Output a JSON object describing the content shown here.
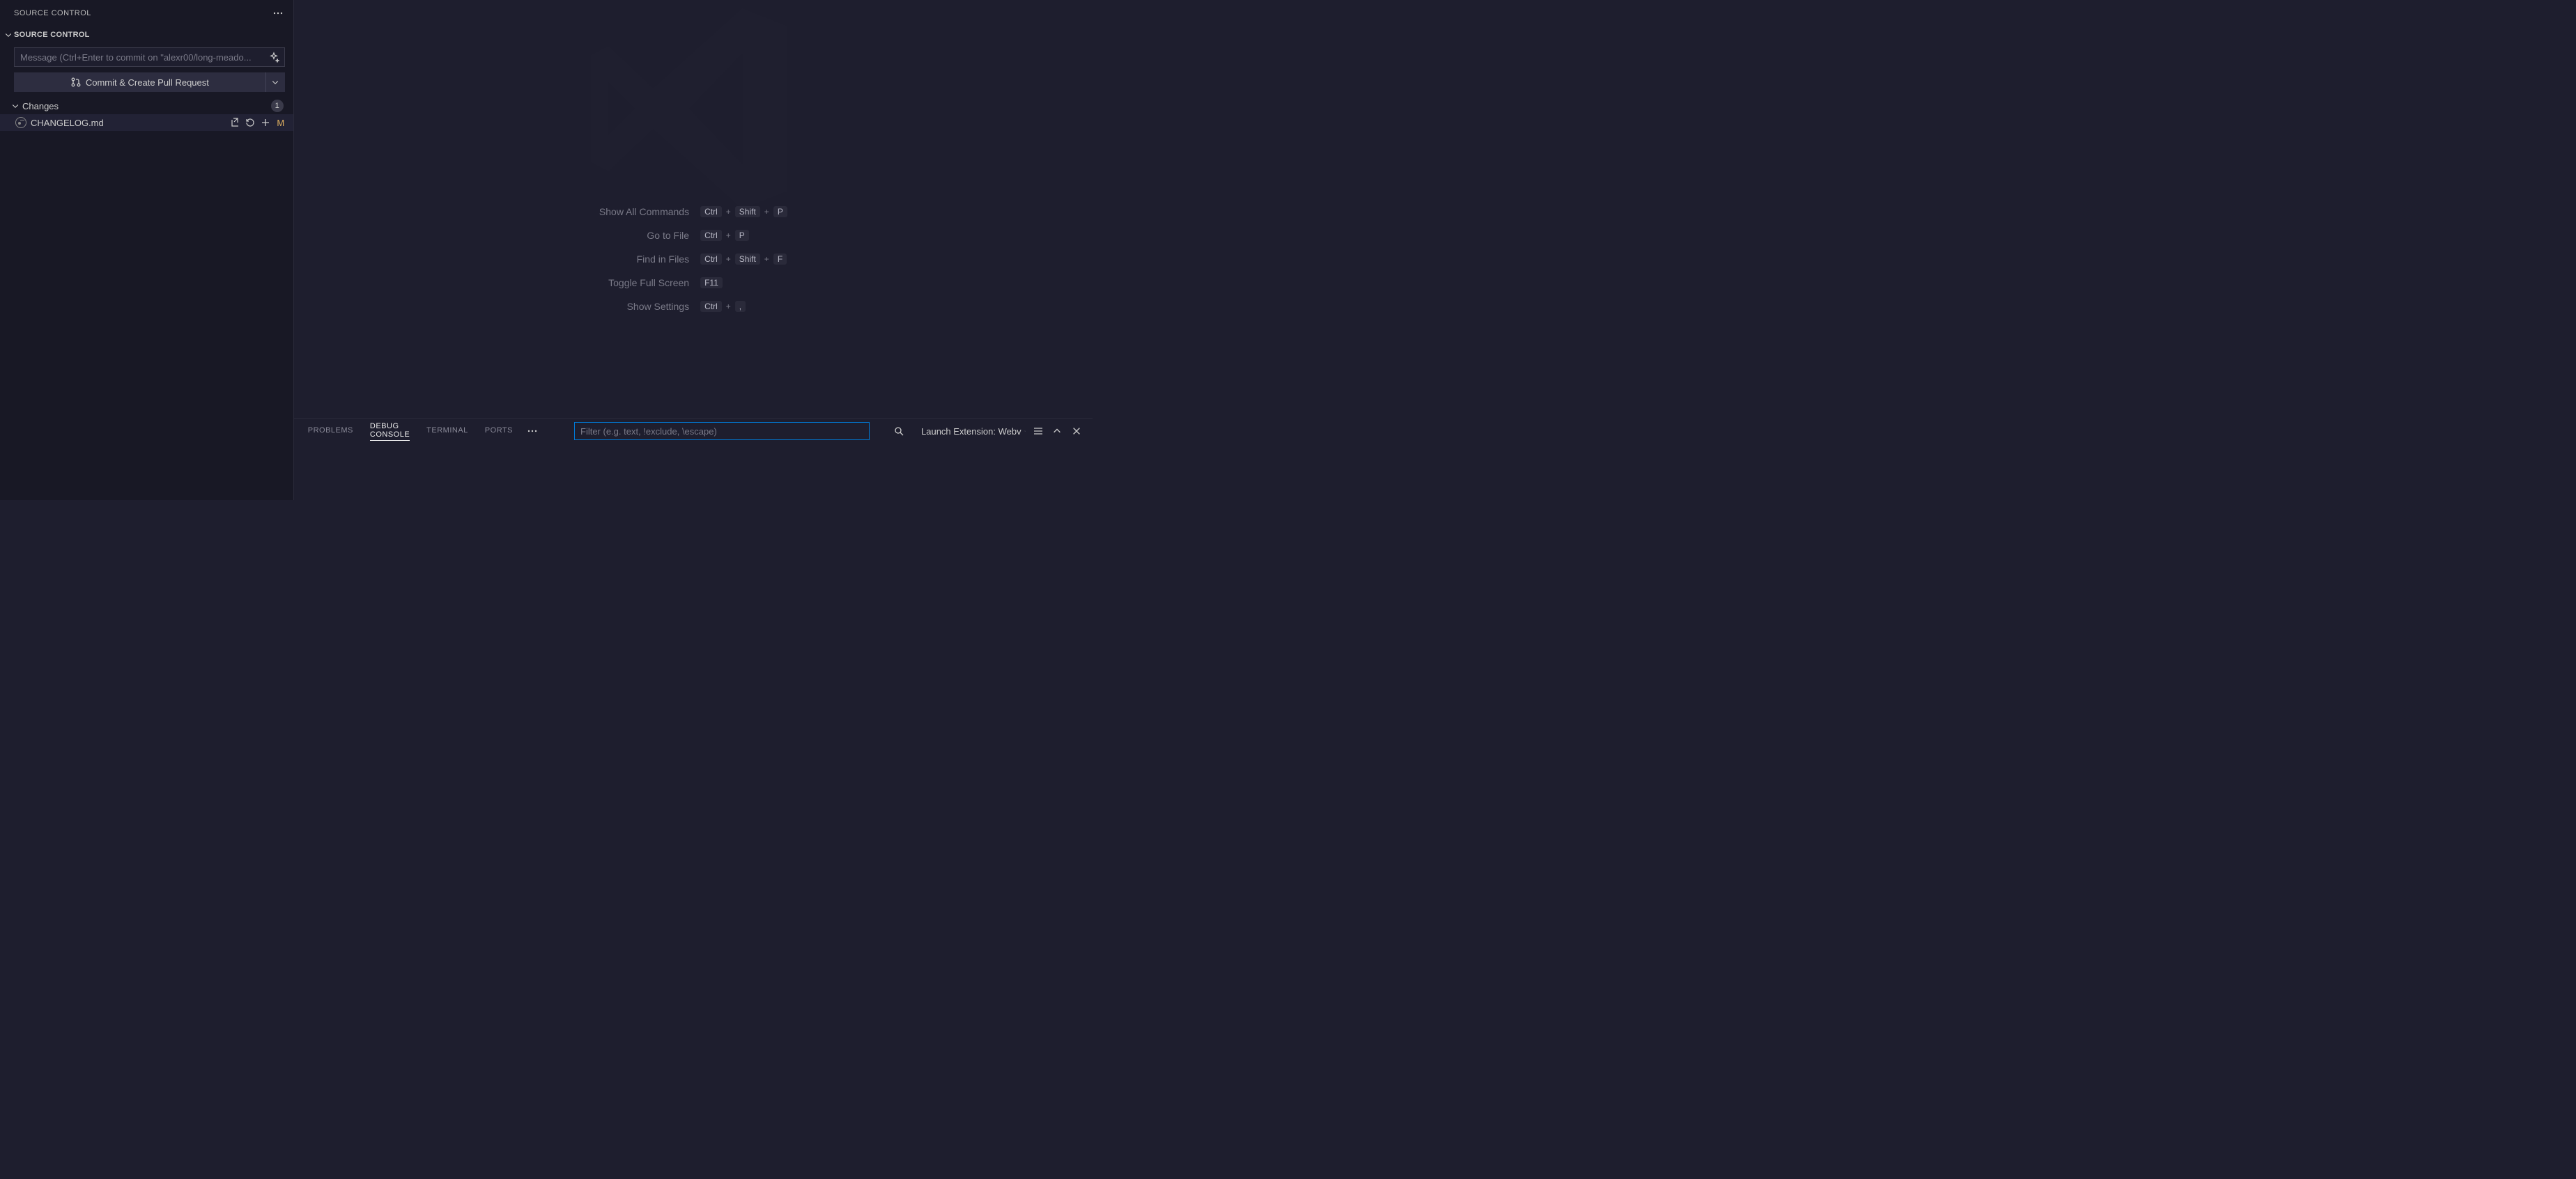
{
  "sidebar": {
    "title": "SOURCE CONTROL",
    "section_label": "SOURCE CONTROL",
    "commit_placeholder": "Message (Ctrl+Enter to commit on \"alexr00/long-meado...",
    "commit_button_label": "Commit & Create Pull Request",
    "changes_label": "Changes",
    "changes_count": "1",
    "files": [
      {
        "name": "CHANGELOG.md",
        "status": "M"
      }
    ]
  },
  "editor_hints": [
    {
      "label": "Show All Commands",
      "keys": [
        "Ctrl",
        "Shift",
        "P"
      ]
    },
    {
      "label": "Go to File",
      "keys": [
        "Ctrl",
        "P"
      ]
    },
    {
      "label": "Find in Files",
      "keys": [
        "Ctrl",
        "Shift",
        "F"
      ]
    },
    {
      "label": "Toggle Full Screen",
      "keys": [
        "F11"
      ]
    },
    {
      "label": "Show Settings",
      "keys": [
        "Ctrl",
        ","
      ]
    }
  ],
  "panel": {
    "tabs": [
      "PROBLEMS",
      "DEBUG CONSOLE",
      "TERMINAL",
      "PORTS"
    ],
    "active_tab_index": 1,
    "filter_placeholder": "Filter (e.g. text, !exclude, \\escape)",
    "launch_target": "Launch Extension: Webv"
  }
}
